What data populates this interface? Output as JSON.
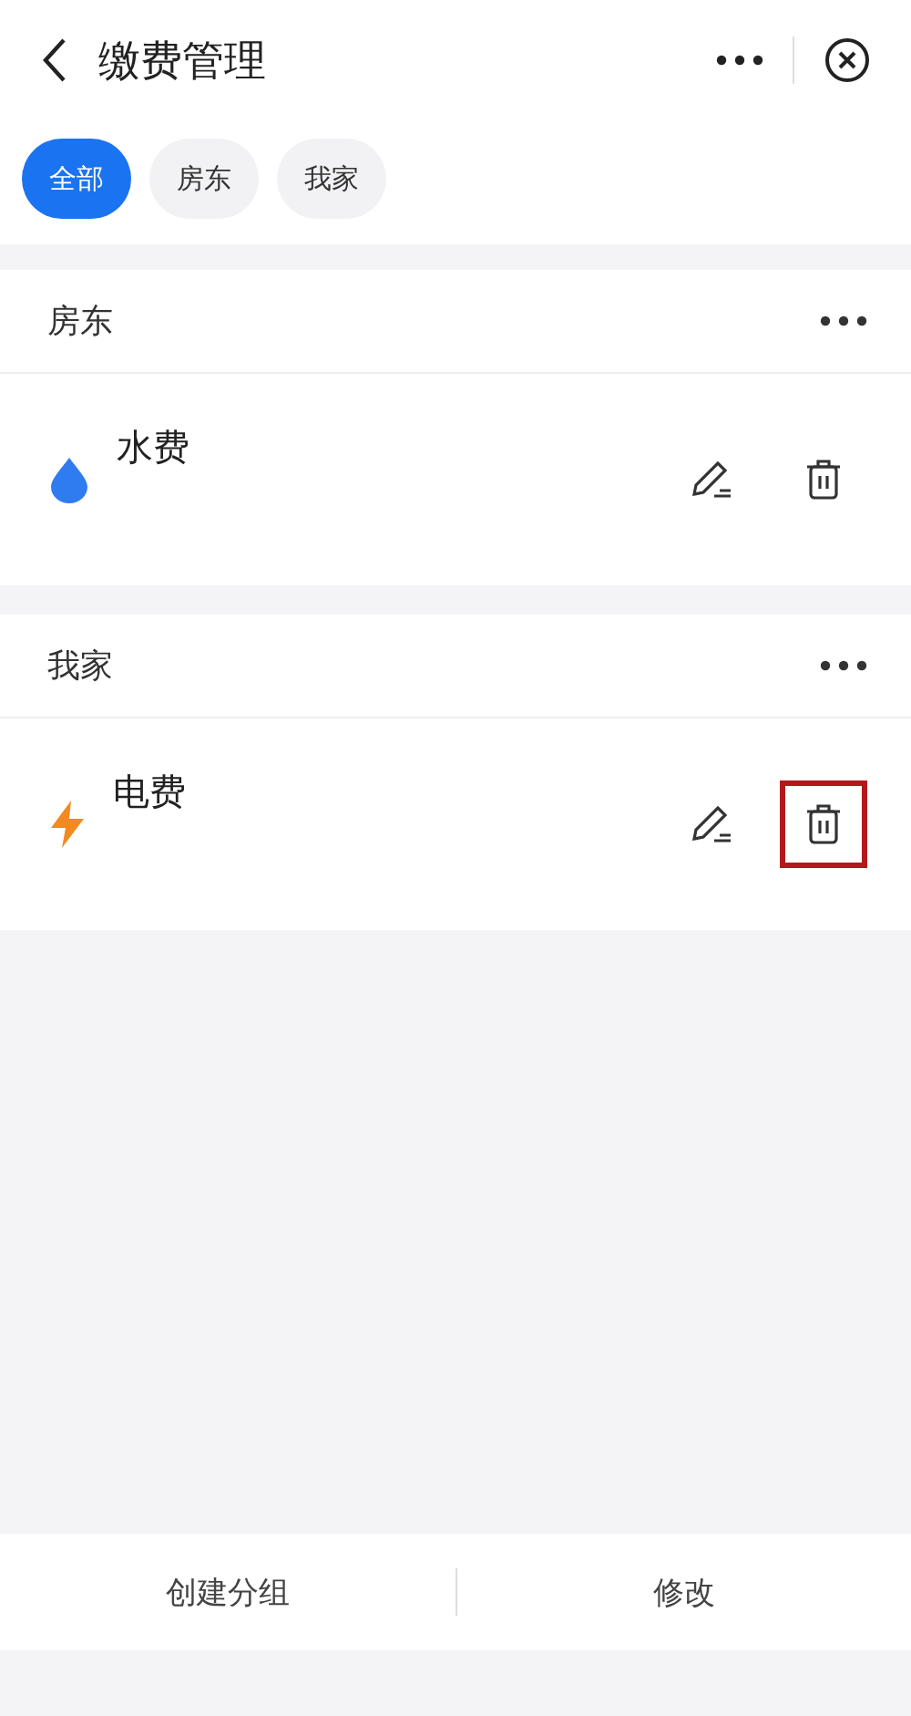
{
  "header": {
    "title": "缴费管理"
  },
  "tabs": [
    {
      "label": "全部",
      "selected": true
    },
    {
      "label": "房东",
      "selected": false
    },
    {
      "label": "我家",
      "selected": false
    }
  ],
  "groups": [
    {
      "name": "房东",
      "items": [
        {
          "kind": "water",
          "label": "水费",
          "delete_highlighted": false
        }
      ]
    },
    {
      "name": "我家",
      "items": [
        {
          "kind": "electric",
          "label": "电费",
          "delete_highlighted": true
        }
      ]
    }
  ],
  "bottom_bar": [
    "创建分组",
    "修改"
  ]
}
